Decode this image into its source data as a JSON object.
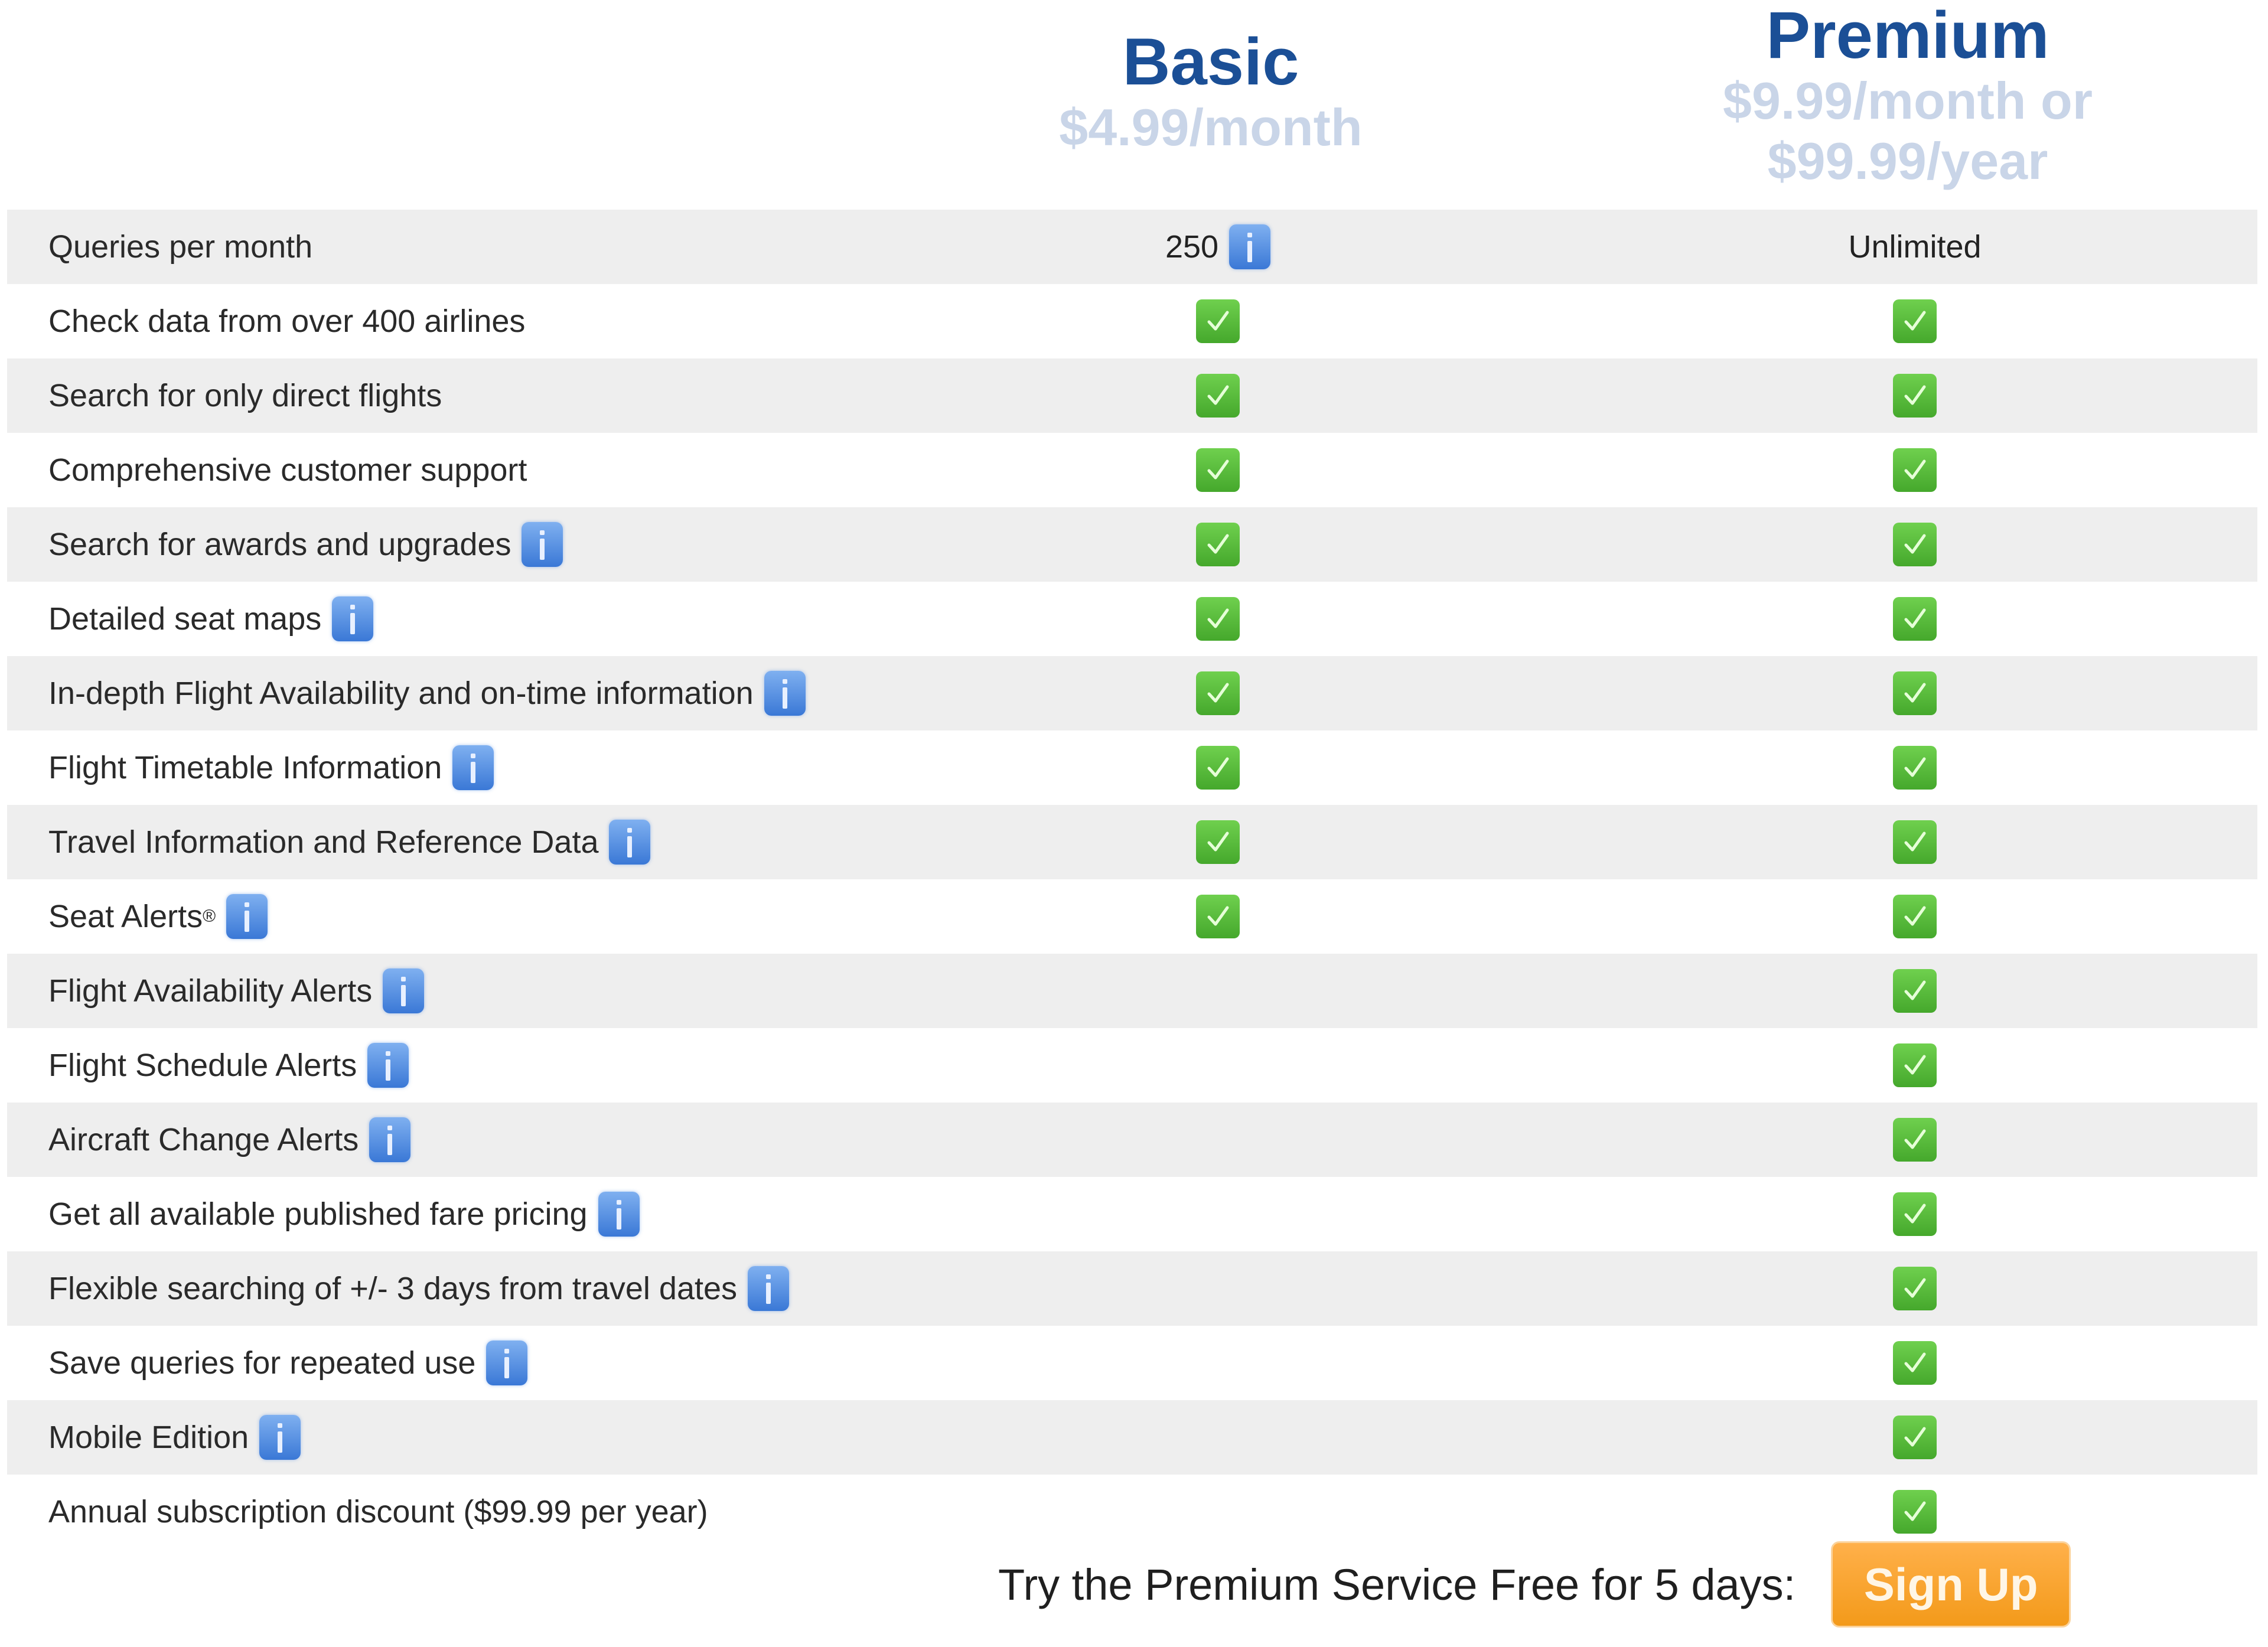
{
  "plans": {
    "basic": {
      "name": "Basic",
      "price": "$4.99/month"
    },
    "premium": {
      "name": "Premium",
      "price_line1": "$9.99/month or",
      "price_line2": "$99.99/year"
    }
  },
  "colors": {
    "plan_name": "#1b4f96",
    "plan_price": "#c9d5e8",
    "row_shade": "#eeeeee",
    "check_green": "#4caf32",
    "info_blue": "#3a78d6",
    "signup_orange": "#f39a1a"
  },
  "features": [
    {
      "label": "Queries per month",
      "info": false,
      "basic": "250",
      "basic_info": true,
      "premium": "Unlimited"
    },
    {
      "label": "Check data from over 400 airlines",
      "info": false,
      "basic": "check",
      "premium": "check"
    },
    {
      "label": "Search for only direct flights",
      "info": false,
      "basic": "check",
      "premium": "check"
    },
    {
      "label": "Comprehensive customer support",
      "info": false,
      "basic": "check",
      "premium": "check"
    },
    {
      "label": "Search for awards and upgrades",
      "info": true,
      "basic": "check",
      "premium": "check"
    },
    {
      "label": "Detailed seat maps",
      "info": true,
      "basic": "check",
      "premium": "check"
    },
    {
      "label": "In-depth Flight Availability and on-time information",
      "info": true,
      "basic": "check",
      "premium": "check"
    },
    {
      "label": "Flight Timetable Information",
      "info": true,
      "basic": "check",
      "premium": "check"
    },
    {
      "label": "Travel Information and Reference Data",
      "info": true,
      "basic": "check",
      "premium": "check"
    },
    {
      "label": "Seat Alerts",
      "sup": "®",
      "info": true,
      "basic": "check",
      "premium": "check"
    },
    {
      "label": "Flight Availability Alerts",
      "info": true,
      "basic": "",
      "premium": "check"
    },
    {
      "label": "Flight Schedule Alerts",
      "info": true,
      "basic": "",
      "premium": "check"
    },
    {
      "label": "Aircraft Change Alerts",
      "info": true,
      "basic": "",
      "premium": "check"
    },
    {
      "label": "Get all available published fare pricing",
      "info": true,
      "basic": "",
      "premium": "check"
    },
    {
      "label": "Flexible searching of +/- 3 days from travel dates",
      "info": true,
      "basic": "",
      "premium": "check"
    },
    {
      "label": "Save queries for repeated use",
      "info": true,
      "basic": "",
      "premium": "check"
    },
    {
      "label": "Mobile Edition",
      "info": true,
      "basic": "",
      "premium": "check"
    },
    {
      "label": "Annual subscription discount ($99.99 per year)",
      "info": false,
      "basic": "",
      "premium": "check"
    }
  ],
  "icons": {
    "info": "info-icon",
    "check": "checkmark-icon"
  },
  "cta": {
    "text": "Try the Premium Service Free for 5 days:",
    "button": "Sign Up"
  }
}
